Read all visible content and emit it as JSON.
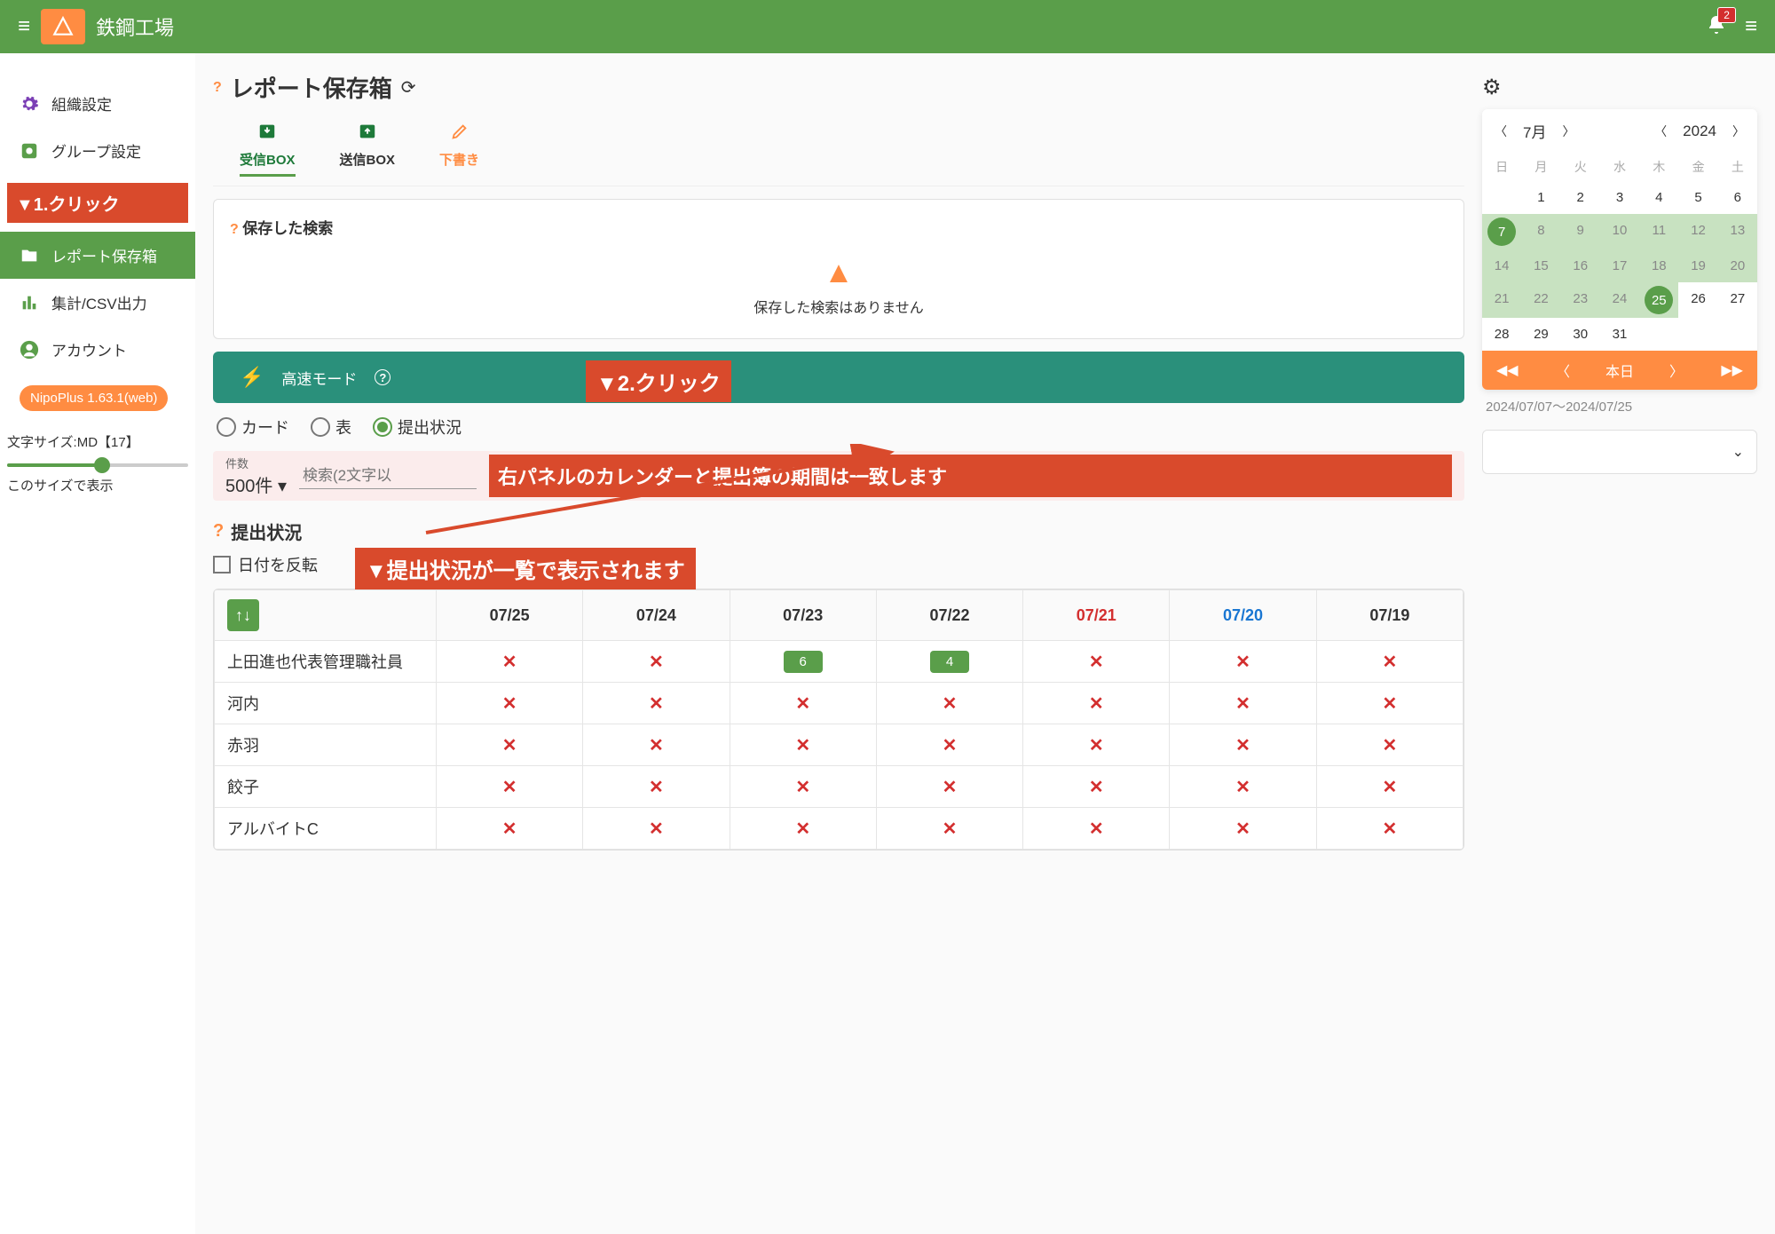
{
  "header": {
    "app_title": "鉄鋼工場",
    "notification_count": "2"
  },
  "sidebar": {
    "items": [
      {
        "label": "組織設定",
        "icon": "gear"
      },
      {
        "label": "グループ設定",
        "icon": "group"
      },
      {
        "label": "レポート保存箱",
        "icon": "folder"
      },
      {
        "label": "集計/CSV出力",
        "icon": "chart"
      },
      {
        "label": "アカウント",
        "icon": "account"
      }
    ],
    "version_chip": "NipoPlus 1.63.1(web)",
    "font_label": "文字サイズ:MD【17】",
    "font_preview": "このサイズで表示"
  },
  "annotations": {
    "a1": "▼1.クリック",
    "a2": "▼2.クリック",
    "a3": "右パネルのカレンダーと提出簿の期間は一致します",
    "a4": "▼提出状況が一覧で表示されます"
  },
  "main": {
    "page_title": "レポート保存箱",
    "tabs": {
      "inbox": "受信BOX",
      "outbox": "送信BOX",
      "draft": "下書き"
    },
    "saved_search": {
      "title": "保存した検索",
      "empty": "保存した検索はありません"
    },
    "fast_mode": "高速モード",
    "view_options": {
      "card": "カード",
      "table": "表",
      "status": "提出状況"
    },
    "count_label": "件数",
    "count_value": "500件",
    "search_placeholder": "検索(2文字以",
    "status_section": "提出状況",
    "reverse_date": "日付を反転"
  },
  "status_table": {
    "columns": [
      "07/25",
      "07/24",
      "07/23",
      "07/22",
      "07/21",
      "07/20",
      "07/19"
    ],
    "column_day_type": [
      "",
      "",
      "",
      "",
      "sat",
      "sun",
      ""
    ],
    "rows": [
      {
        "name": "上田進也代表管理職社員",
        "cells": [
          "x",
          "x",
          "6",
          "4",
          "x",
          "x",
          "x"
        ]
      },
      {
        "name": "河内",
        "cells": [
          "x",
          "x",
          "x",
          "x",
          "x",
          "x",
          "x"
        ]
      },
      {
        "name": "赤羽",
        "cells": [
          "x",
          "x",
          "x",
          "x",
          "x",
          "x",
          "x"
        ]
      },
      {
        "name": "餃子",
        "cells": [
          "x",
          "x",
          "x",
          "x",
          "x",
          "x",
          "x"
        ]
      },
      {
        "name": "アルバイトC",
        "cells": [
          "x",
          "x",
          "x",
          "x",
          "x",
          "x",
          "x"
        ]
      }
    ]
  },
  "calendar": {
    "month_label": "7月",
    "year_label": "2024",
    "dow": [
      "日",
      "月",
      "火",
      "水",
      "木",
      "金",
      "土"
    ],
    "weeks": [
      [
        "",
        "1",
        "2",
        "3",
        "4",
        "5",
        "6"
      ],
      [
        "7",
        "8",
        "9",
        "10",
        "11",
        "12",
        "13"
      ],
      [
        "14",
        "15",
        "16",
        "17",
        "18",
        "19",
        "20"
      ],
      [
        "21",
        "22",
        "23",
        "24",
        "25",
        "26",
        "27"
      ],
      [
        "28",
        "29",
        "30",
        "31",
        "",
        "",
        ""
      ]
    ],
    "range_start": "7",
    "range_end": "25",
    "today_label": "本日",
    "range_text": "2024/07/07〜2024/07/25"
  }
}
